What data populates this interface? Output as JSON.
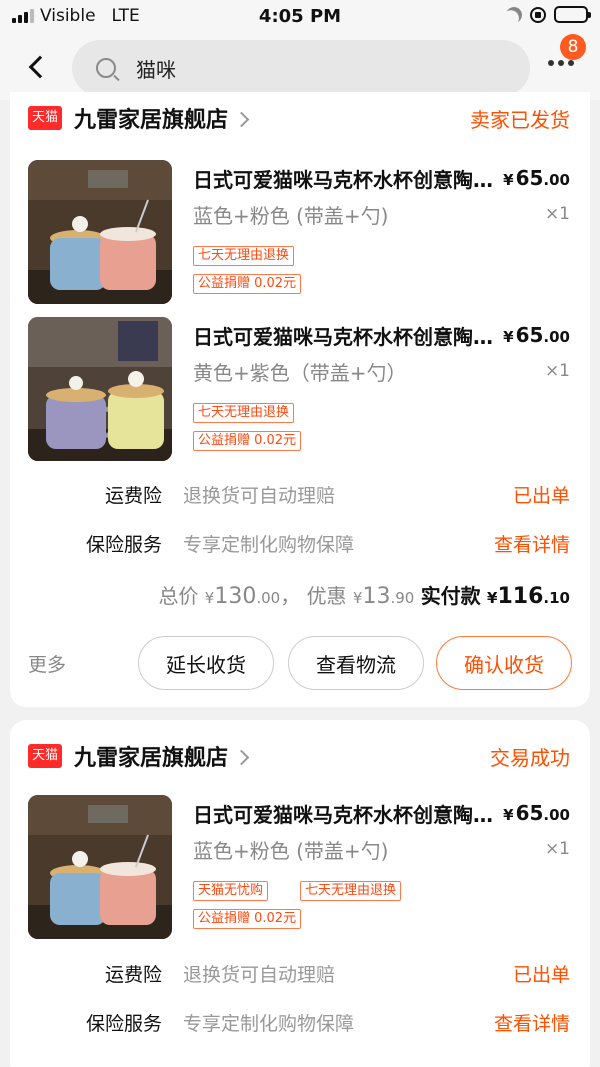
{
  "status_bar": {
    "carrier": "Visible",
    "network": "LTE",
    "time": "4:05 PM"
  },
  "header": {
    "search_query": "猫咪",
    "notification_count": "8"
  },
  "orders": [
    {
      "store_badge": "天猫",
      "store_name": "九雷家居旗舰店",
      "status": "卖家已发货",
      "items": [
        {
          "title": "日式可爱猫咪马克杯水杯创意陶瓷杯",
          "currency": "¥",
          "price_int": "65",
          "price_dec": ".00",
          "sku": "蓝色+粉色 (带盖+勺)",
          "qty": "×1",
          "tags": [
            "七天无理由退换",
            "公益捐赠 0.02元"
          ]
        },
        {
          "title": "日式可爱猫咪马克杯水杯创意陶瓷杯",
          "currency": "¥",
          "price_int": "65",
          "price_dec": ".00",
          "sku": "黄色+紫色（带盖+勺）",
          "qty": "×1",
          "tags": [
            "七天无理由退换",
            "公益捐赠 0.02元"
          ]
        }
      ],
      "services": [
        {
          "label": "运费险",
          "desc": "退换货可自动理赔",
          "action": "已出单"
        },
        {
          "label": "保险服务",
          "desc": "专享定制化购物保障",
          "action": "查看详情"
        }
      ],
      "totals": {
        "total_label": "总价",
        "currency": "¥",
        "total_int": "130",
        "total_dec": ".00",
        "sep": "，",
        "discount_label": "优惠",
        "discount_int": "13",
        "discount_dec": ".90",
        "paid_label": "实付款",
        "paid_int": "116",
        "paid_dec": ".10"
      },
      "more_label": "更多",
      "buttons": [
        "延长收货",
        "查看物流",
        "确认收货"
      ]
    },
    {
      "store_badge": "天猫",
      "store_name": "九雷家居旗舰店",
      "status": "交易成功",
      "items": [
        {
          "title": "日式可爱猫咪马克杯水杯创意陶瓷杯",
          "currency": "¥",
          "price_int": "65",
          "price_dec": ".00",
          "sku": "蓝色+粉色 (带盖+勺)",
          "qty": "×1",
          "tags": [
            "天猫无忧购",
            "七天无理由退换",
            "公益捐赠 0.02元"
          ]
        }
      ],
      "services": [
        {
          "label": "运费险",
          "desc": "退换货可自动理赔",
          "action": "已出单"
        },
        {
          "label": "保险服务",
          "desc": "专享定制化购物保障",
          "action": "查看详情"
        }
      ]
    }
  ],
  "colors": {
    "accent": "#ff5000",
    "tmall_red": "#ff2a2a",
    "badge": "#ff5a1f"
  }
}
